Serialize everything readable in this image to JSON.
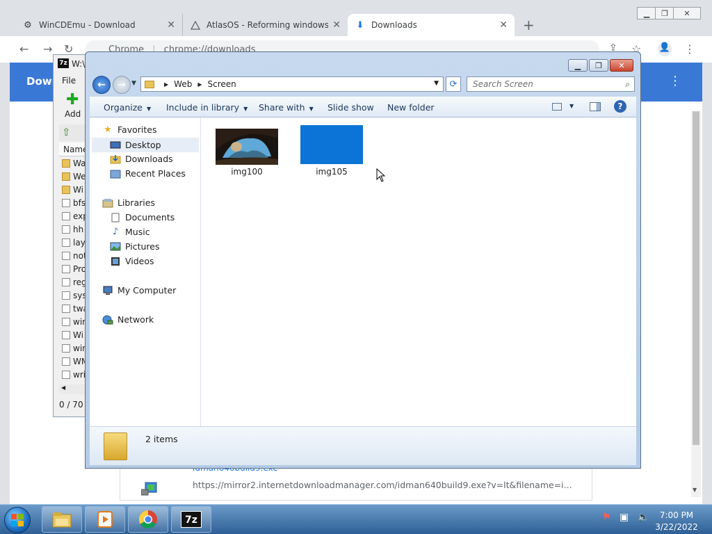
{
  "desktop": {
    "edge_letters": [
      "M",
      "D"
    ]
  },
  "chrome": {
    "tabs": [
      {
        "label": "WinCDEmu - Download",
        "icon": "gear-icon"
      },
      {
        "label": "AtlasOS - Reforming windows fo",
        "icon": "warning-triangle-icon"
      },
      {
        "label": "Downloads",
        "icon": "download-arrow-icon",
        "active": true
      }
    ],
    "new_tab": "+",
    "omnibox_site": "Chrome",
    "omnibox_url": "chrome://downloads",
    "page_title": "Down",
    "download": {
      "filename": "idman640build9.exe",
      "url": "https://mirror2.internetdownloadmanager.com/idman640build9.exe?v=lt&filename=i..."
    }
  },
  "sevenzip": {
    "title": "W:\\",
    "menu_file": "File",
    "add_label": "Add",
    "column_name": "Name",
    "rows": [
      {
        "name": "Wa",
        "type": "folder"
      },
      {
        "name": "We",
        "type": "folder"
      },
      {
        "name": "Wi",
        "type": "folder"
      },
      {
        "name": "bfs",
        "type": "file"
      },
      {
        "name": "exp",
        "type": "file"
      },
      {
        "name": "hh",
        "type": "file"
      },
      {
        "name": "lay",
        "type": "file"
      },
      {
        "name": "not",
        "type": "file"
      },
      {
        "name": "Pro",
        "type": "file"
      },
      {
        "name": "reg",
        "type": "file"
      },
      {
        "name": "sys",
        "type": "file"
      },
      {
        "name": "twa",
        "type": "file"
      },
      {
        "name": "win",
        "type": "file"
      },
      {
        "name": "Wi",
        "type": "file"
      },
      {
        "name": "win",
        "type": "file"
      },
      {
        "name": "WM",
        "type": "file"
      },
      {
        "name": "wri",
        "type": "file"
      }
    ],
    "status": "0 / 70 o"
  },
  "explorer": {
    "breadcrumb": [
      "Web",
      "Screen"
    ],
    "search_placeholder": "Search Screen",
    "commands": {
      "organize": "Organize",
      "include_in_library": "Include in library",
      "share_with": "Share with",
      "slide_show": "Slide show",
      "new_folder": "New folder"
    },
    "nav": {
      "favorites": "Favorites",
      "desktop": "Desktop",
      "downloads": "Downloads",
      "recent_places": "Recent Places",
      "libraries": "Libraries",
      "documents": "Documents",
      "music": "Music",
      "pictures": "Pictures",
      "videos": "Videos",
      "my_computer": "My Computer",
      "network": "Network"
    },
    "files": [
      {
        "name": "img100",
        "preview": "cave-landscape"
      },
      {
        "name": "img105",
        "preview": "solid-blue",
        "color": "#0c74d6"
      }
    ],
    "item_count": "2 items"
  },
  "taskbar": {
    "time": "7:00 PM",
    "date": "3/22/2022",
    "pinned": [
      "explorer-icon",
      "media-player-icon",
      "chrome-icon",
      "7zip-icon"
    ],
    "sevenzip_label": "7z"
  },
  "colors": {
    "accent_blue": "#3a78d6",
    "taskbar": "#2e5f96",
    "img105_fill": "#0c74d6"
  }
}
